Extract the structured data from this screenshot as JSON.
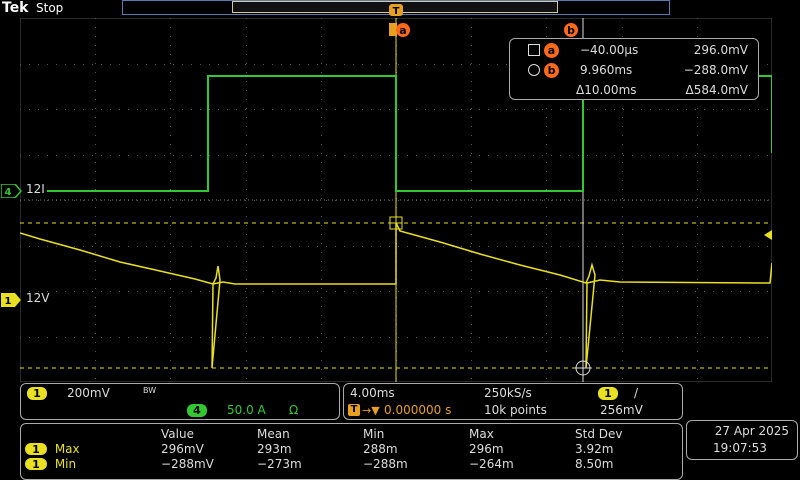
{
  "topbar": {
    "brand": "Tek",
    "status": "Stop"
  },
  "colors": {
    "ch1": "#e8e020",
    "ch4": "#32c832",
    "cursor": "#ff6a1a",
    "grid": "#555555"
  },
  "trigger": {
    "marker_label": "T"
  },
  "cursors": {
    "a_label": "a",
    "b_label": "b",
    "readout": {
      "a_time": "−40.00µs",
      "a_value": "296.0mV",
      "b_time": "9.960ms",
      "b_value": "−288.0mV",
      "delta_time": "Δ10.00ms",
      "delta_value": "Δ584.0mV"
    }
  },
  "channels": {
    "ch4": {
      "number": "4",
      "label": "12I",
      "scale": "50.0 A",
      "unit_icon": "Ω"
    },
    "ch1": {
      "number": "1",
      "label": "12V",
      "scale": "200mV",
      "bw_icon": "BW"
    }
  },
  "timebase": {
    "scale": "4.00ms",
    "sample_rate": "250kS/s",
    "position": "0.000000 s",
    "record_length": "10k points",
    "trig_source": "1",
    "trig_slope": "/",
    "trig_level": "256mV"
  },
  "measurements": {
    "headers": [
      "Value",
      "Mean",
      "Min",
      "Max",
      "Std Dev"
    ],
    "rows": [
      {
        "channel": "1",
        "name": "Max",
        "values": [
          "296mV",
          "293m",
          "288m",
          "296m",
          "3.92m"
        ]
      },
      {
        "channel": "1",
        "name": "Min",
        "values": [
          "−288mV",
          "−273m",
          "−288m",
          "−264m",
          "8.50m"
        ]
      }
    ]
  },
  "datetime": {
    "date": "27 Apr  2025",
    "time": "19:07:53"
  }
}
